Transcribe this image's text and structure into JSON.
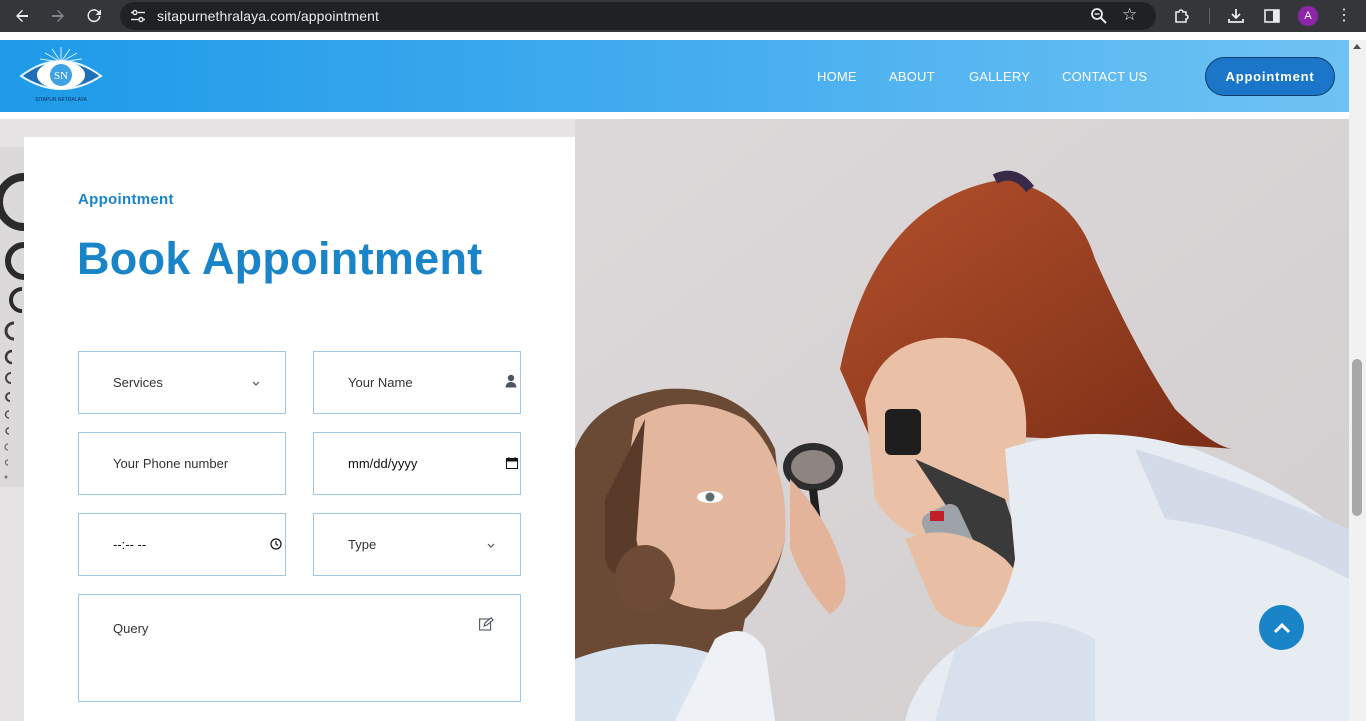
{
  "browser": {
    "url": "sitapurnethralaya.com/appointment",
    "profile_initial": "A"
  },
  "header": {
    "logo_text": "SITAPUR NETRALAYA",
    "logo_initials": "SN",
    "nav": [
      "HOME",
      "ABOUT",
      "GALLERY",
      "CONTACT US"
    ],
    "cta_label": "Appointment"
  },
  "form": {
    "eyebrow": "Appointment",
    "title": "Book Appointment",
    "services_label": "Services",
    "name_placeholder": "Your Name",
    "phone_placeholder": "Your Phone number",
    "date_placeholder": "mm/dd/yyyy",
    "time_placeholder": "--:-- --",
    "type_label": "Type",
    "query_placeholder": "Query"
  },
  "colors": {
    "brand_blue": "#1a84c8",
    "header_gradient_start": "#1e9ae8",
    "button_blue": "#1b75c9"
  },
  "icons": {
    "back": "arrow-left-icon",
    "forward": "arrow-right-icon",
    "reload": "reload-icon",
    "site_info": "tune-icon",
    "zoom": "magnifier-icon",
    "bookmark": "star-icon",
    "extensions": "puzzle-icon",
    "downloads": "download-icon",
    "side_panel": "side-panel-icon",
    "menu": "kebab-icon",
    "scroll_top": "chevron-up-icon"
  }
}
